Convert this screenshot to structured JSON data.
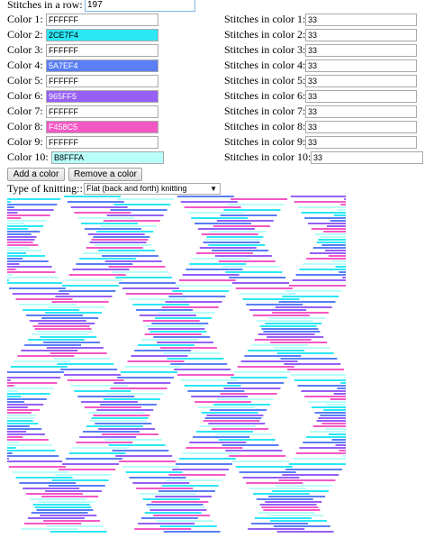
{
  "stitches_row": {
    "label": "Stitches in a row:",
    "value": "197"
  },
  "colors": [
    {
      "label": "Color 1:",
      "hex": "FFFFFF",
      "stitch_label": "Stitches in color 1:",
      "stitches": "33"
    },
    {
      "label": "Color 2:",
      "hex": "2CE7F4",
      "stitch_label": "Stitches in color 2:",
      "stitches": "33"
    },
    {
      "label": "Color 3:",
      "hex": "FFFFFF",
      "stitch_label": "Stitches in color 3:",
      "stitches": "33"
    },
    {
      "label": "Color 4:",
      "hex": "5A7EF4",
      "stitch_label": "Stitches in color 4:",
      "stitches": "33"
    },
    {
      "label": "Color 5:",
      "hex": "FFFFFF",
      "stitch_label": "Stitches in color 5:",
      "stitches": "33"
    },
    {
      "label": "Color 6:",
      "hex": "965FF5",
      "stitch_label": "Stitches in color 6:",
      "stitches": "33"
    },
    {
      "label": "Color 7:",
      "hex": "FFFFFF",
      "stitch_label": "Stitches in color 7:",
      "stitches": "33"
    },
    {
      "label": "Color 8:",
      "hex": "F458C5",
      "stitch_label": "Stitches in color 8:",
      "stitches": "33"
    },
    {
      "label": "Color 9:",
      "hex": "FFFFFF",
      "stitch_label": "Stitches in color 9:",
      "stitches": "33"
    },
    {
      "label": "Color 10:",
      "hex": "B8FFFA",
      "stitch_label": "Stitches in color 10:",
      "stitches": "33"
    }
  ],
  "buttons": {
    "add": "Add a color",
    "remove": "Remove a color"
  },
  "knitting": {
    "label": "Type of knitting::",
    "selected": "Flat (back and forth) knitting"
  }
}
